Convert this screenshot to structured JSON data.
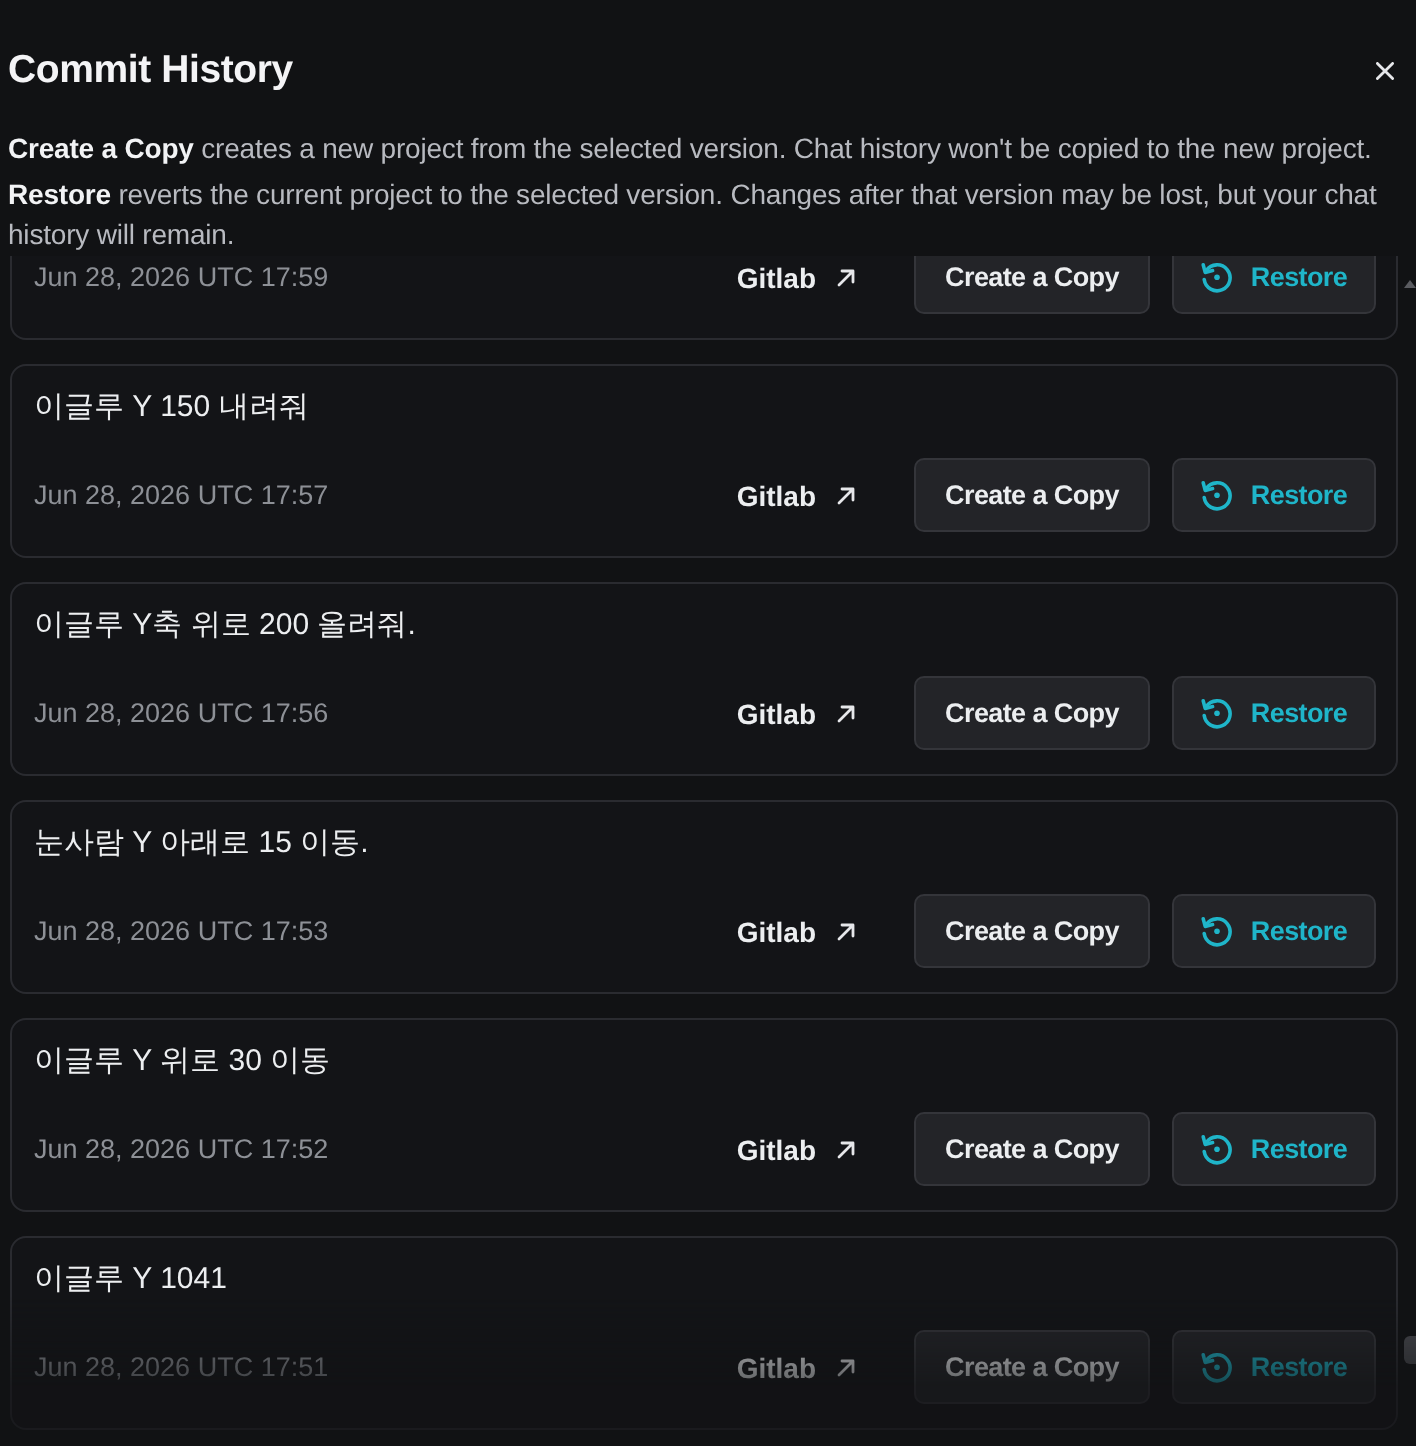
{
  "dialog": {
    "title": "Commit History"
  },
  "notes": [
    {
      "text": "**Create a Copy** creates a new project from the selected version. Chat history won't be copied to the new project."
    },
    {
      "text": "**Restore** reverts the current project to the selected version. Changes after that version may be lost, but your chat history will remain."
    }
  ],
  "commits": [
    {
      "date": "Jun 28, 2026 UTC 17:59",
      "link": "Gitlab",
      "copy_button": "Create a Copy",
      "restore_button": "Restore"
    },
    {
      "message": "이글루 Y 150 내려줘",
      "date": "Jun 28, 2026 UTC 17:57",
      "link": "Gitlab",
      "copy_button": "Create a Copy",
      "restore_button": "Restore"
    },
    {
      "message": "이글루 Y축 위로 200 올려줘.",
      "date": "Jun 28, 2026 UTC 17:56",
      "link": "Gitlab",
      "copy_button": "Create a Copy",
      "restore_button": "Restore"
    },
    {
      "message": "눈사람 Y 아래로 15 이동.",
      "date": "Jun 28, 2026 UTC 17:53",
      "link": "Gitlab",
      "copy_button": "Create a Copy",
      "restore_button": "Restore"
    },
    {
      "message": "이글루 Y 위로 30 이동",
      "date": "Jun 28, 2026 UTC 17:52",
      "link": "Gitlab",
      "copy_button": "Create a Copy",
      "restore_button": "Restore"
    },
    {
      "message": "이글루 Y 1041",
      "date": "Jun 28, 2026 UTC 17:51",
      "link": "Gitlab",
      "copy_button": "Create a Copy",
      "restore_button": "Restore"
    }
  ]
}
